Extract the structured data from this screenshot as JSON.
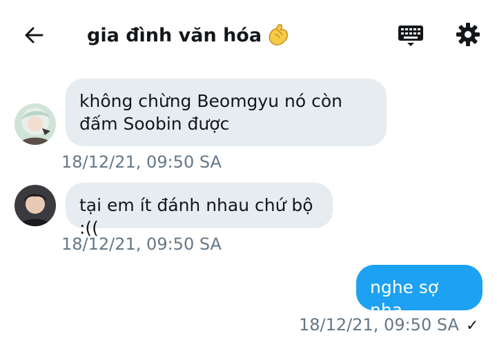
{
  "header": {
    "title": "gia đình văn hóa",
    "title_emoji": "pinching-hand-emoji",
    "back_icon": "arrow-left-icon",
    "keyboard_icon": "keyboard-icon",
    "settings_icon": "gear-icon"
  },
  "messages": [
    {
      "direction": "received",
      "text": "không chừng Beomgyu nó còn đấm Soobin được",
      "timestamp": "18/12/21, 09:50 SA"
    },
    {
      "direction": "received",
      "text": "tại em ít đánh nhau chứ bộ :((",
      "timestamp": "18/12/21, 09:50 SA"
    },
    {
      "direction": "sent",
      "text": "nghe sợ nha",
      "timestamp": "18/12/21, 09:50 SA",
      "status_icon": "checkmark-icon"
    }
  ],
  "colors": {
    "sent_bubble": "#1da1f2",
    "received_bubble": "#e6ecf0",
    "timestamp": "#657786"
  }
}
